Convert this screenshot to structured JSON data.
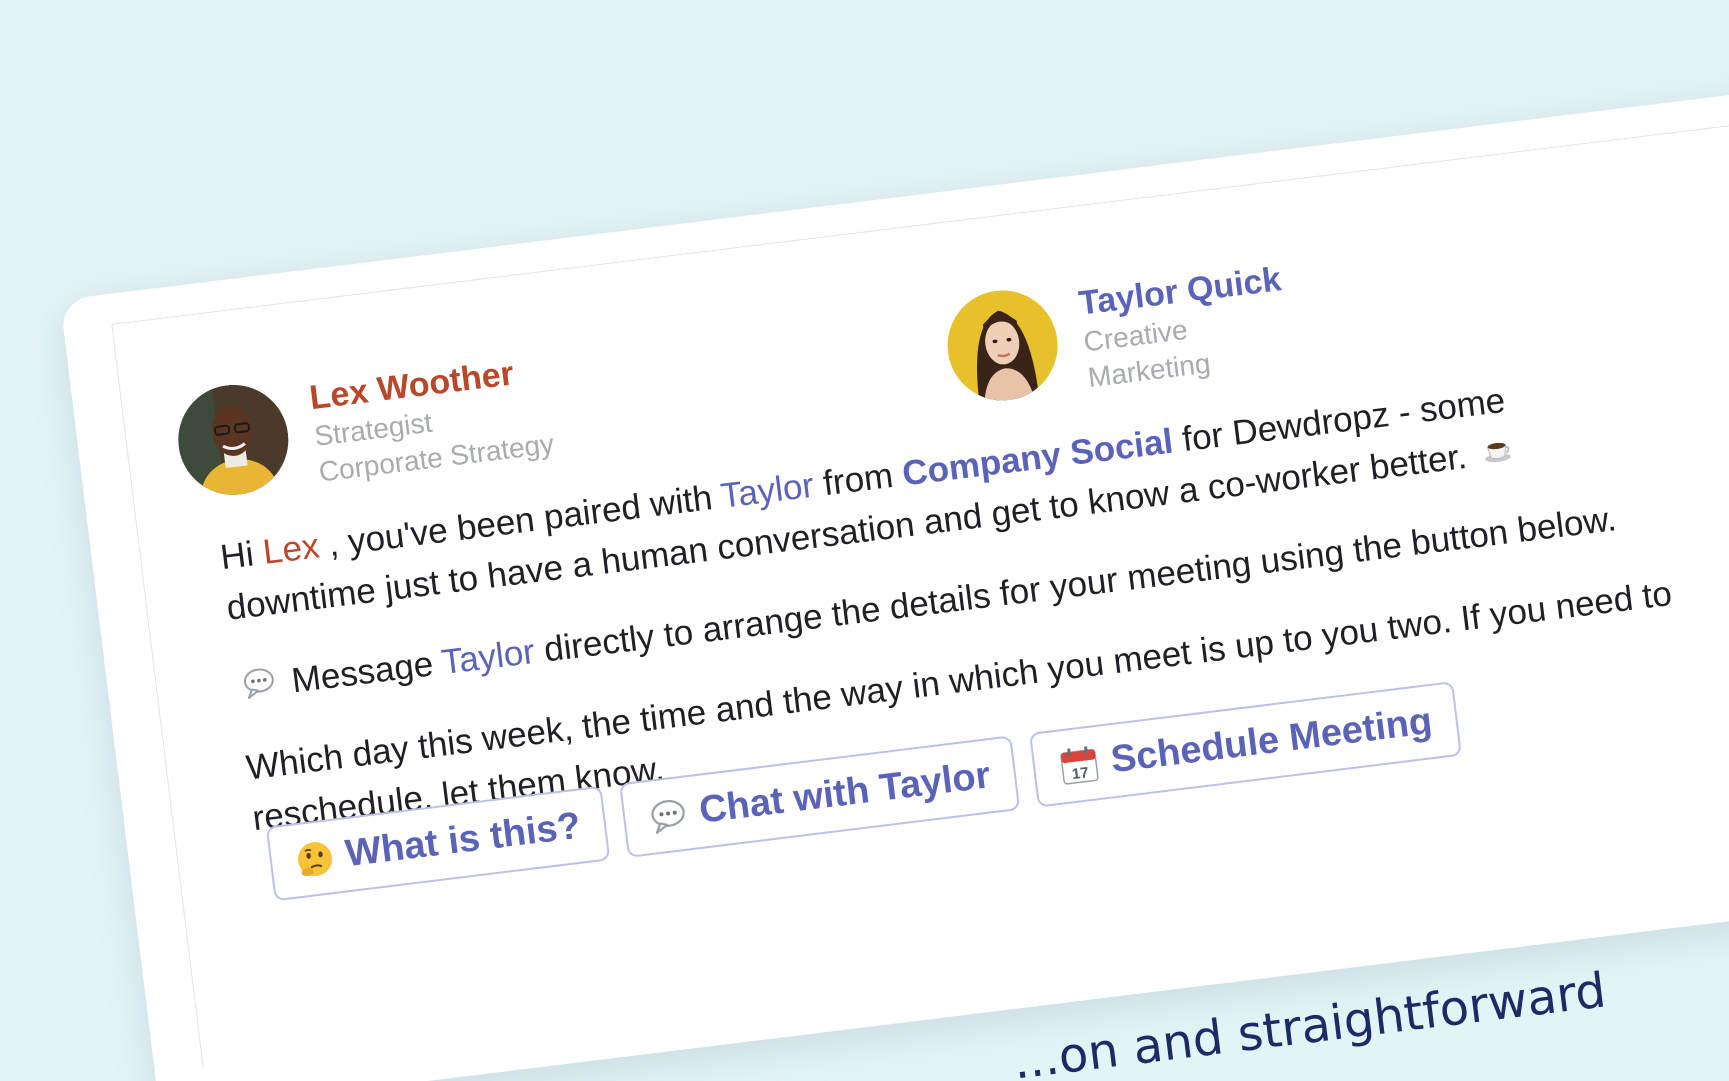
{
  "profiles": {
    "lex": {
      "name": "Lex Woother",
      "role": "Strategist",
      "department": "Corporate Strategy"
    },
    "taylor": {
      "name": "Taylor Quick",
      "role": "Creative",
      "department": "Marketing"
    }
  },
  "message": {
    "p1": {
      "greeting": "Hi",
      "user": "Lex",
      "text1": ", you've been paired with",
      "partner": "Taylor",
      "text2": "from",
      "channel": "Company Social",
      "text3": "for Dewdropz - some downtime just to have a human conversation and get to know a co-worker better."
    },
    "p2": {
      "text1": "Message",
      "partner": "Taylor",
      "text2": "directly to arrange the details for your meeting using the button below."
    },
    "p3": {
      "text": "Which day this week, the time and the way in which you meet is up to you two. If you need to reschedule, let them know."
    }
  },
  "buttons": {
    "what": "What is this?",
    "chat": "Chat with Taylor",
    "schedule": "Schedule Meeting",
    "calendar_day": "17"
  },
  "footer_text": "...on and straightforward",
  "icons": [
    "coffee-icon",
    "speech-bubble-icon",
    "thinking-face-icon",
    "calendar-icon"
  ],
  "colors": {
    "background": "#e3f4f6",
    "lex_accent": "#b9482b",
    "taylor_accent": "#5a63b8",
    "button_border": "#bcc1e8",
    "muted": "#a8abb1"
  }
}
